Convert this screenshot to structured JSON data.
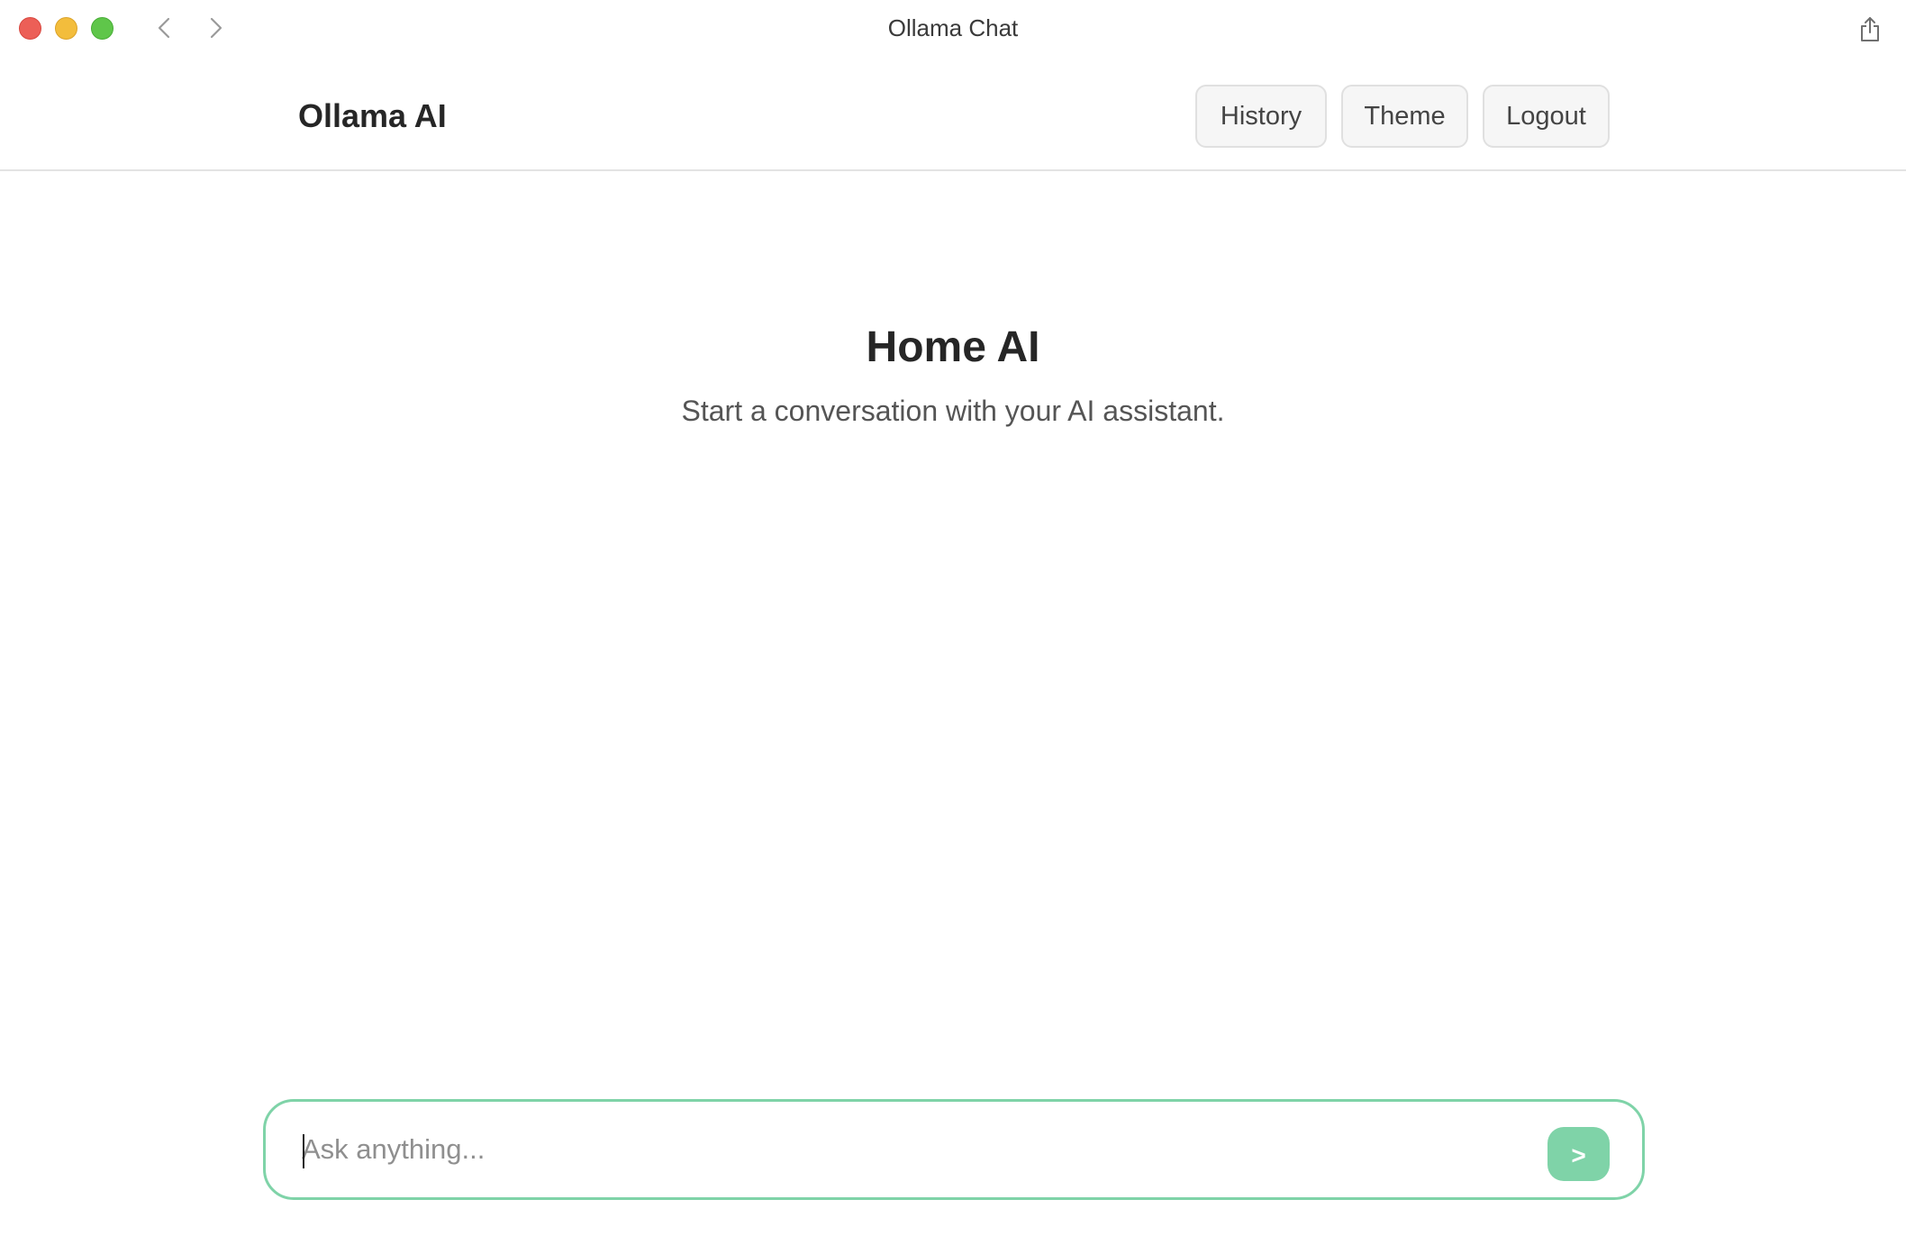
{
  "window": {
    "title": "Ollama Chat",
    "controls": [
      "close",
      "minimize",
      "maximize"
    ],
    "nav": {
      "back_icon": "chevron-left-icon",
      "forward_icon": "chevron-right-icon"
    },
    "share_icon": "share-icon"
  },
  "header": {
    "brand": "Ollama AI",
    "buttons": {
      "history": "History",
      "theme": "Theme",
      "logout": "Logout"
    }
  },
  "main": {
    "title": "Home AI",
    "subtitle": "Start a conversation with your AI assistant."
  },
  "composer": {
    "value": "",
    "placeholder": "Ask anything...",
    "send_label": ">"
  },
  "colors": {
    "accent": "#7fd3a8",
    "close": "#ec5f57",
    "minimize": "#f3bd3c",
    "maximize": "#5fc64a"
  }
}
